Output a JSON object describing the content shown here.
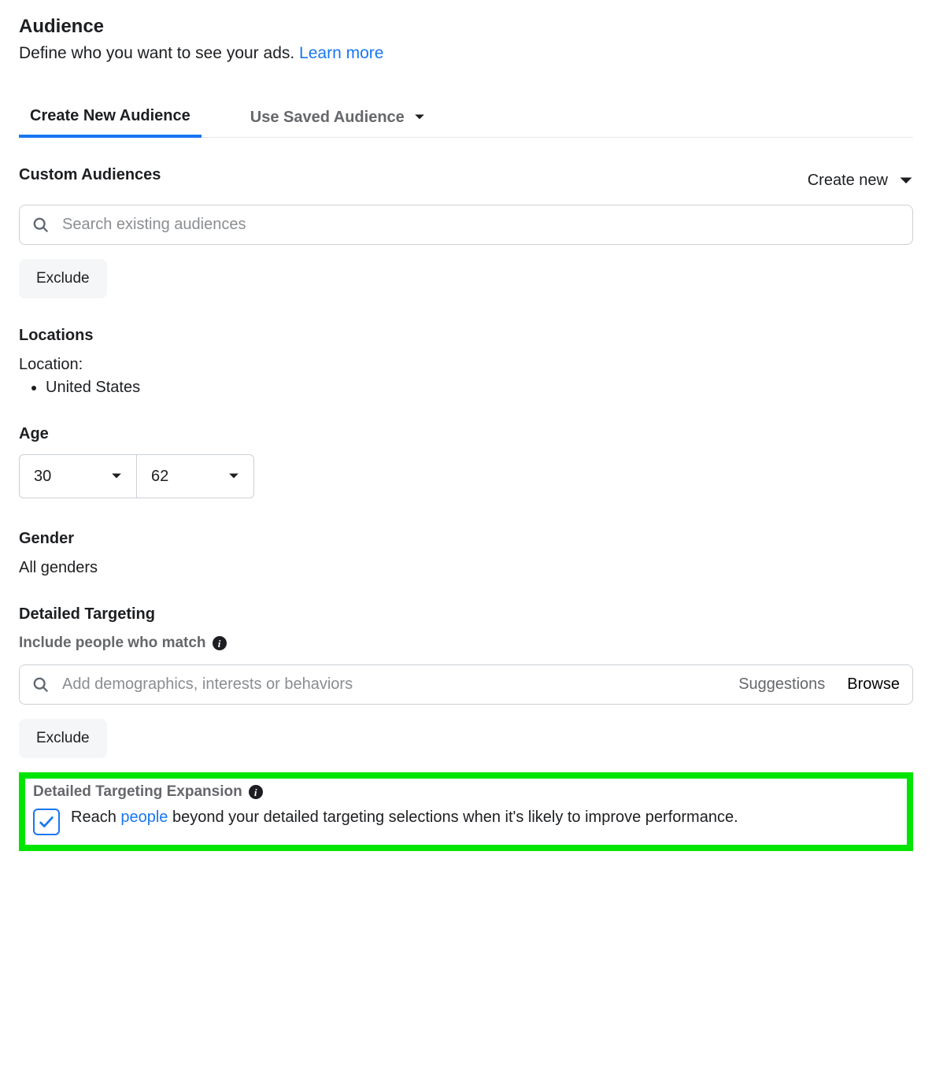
{
  "header": {
    "title": "Audience",
    "subtitle_prefix": "Define who you want to see your ads. ",
    "learn_more": "Learn more"
  },
  "tabs": {
    "create": "Create New Audience",
    "saved": "Use Saved Audience"
  },
  "custom_audiences": {
    "label": "Custom Audiences",
    "create_new": "Create new",
    "search_placeholder": "Search existing audiences",
    "exclude": "Exclude"
  },
  "locations": {
    "label": "Locations",
    "prefix": "Location:",
    "items": [
      "United States"
    ]
  },
  "age": {
    "label": "Age",
    "min": "30",
    "max": "62"
  },
  "gender": {
    "label": "Gender",
    "value": "All genders"
  },
  "detailed": {
    "label": "Detailed Targeting",
    "sublabel": "Include people who match",
    "search_placeholder": "Add demographics, interests or behaviors",
    "suggestions": "Suggestions",
    "browse": "Browse",
    "exclude": "Exclude"
  },
  "expansion": {
    "label": "Detailed Targeting Expansion",
    "text_prefix": "Reach ",
    "text_link": "people",
    "text_suffix": " beyond your detailed targeting selections when it's likely to improve performance."
  }
}
